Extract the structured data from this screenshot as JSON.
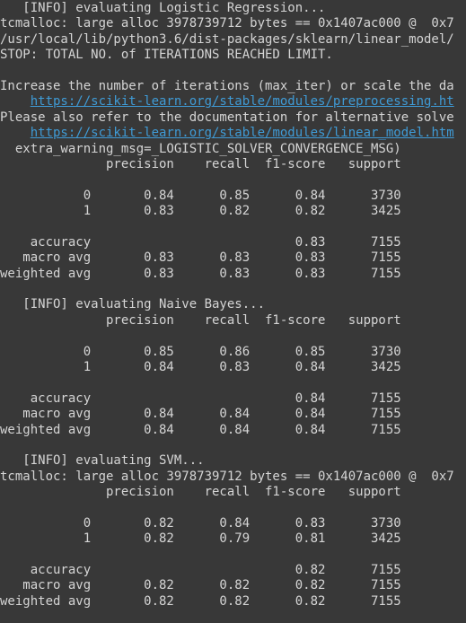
{
  "terminal": {
    "lines": [
      {
        "text": "   [INFO] evaluating Logistic Regression..."
      },
      {
        "text": "tcmalloc: large alloc 3978739712 bytes == 0x1407ac000 @  0x7"
      },
      {
        "text": "/usr/local/lib/python3.6/dist-packages/sklearn/linear_model/"
      },
      {
        "text": "STOP: TOTAL NO. of ITERATIONS REACHED LIMIT."
      },
      {
        "text": ""
      },
      {
        "text": "Increase the number of iterations (max_iter) or scale the da"
      },
      {
        "text": "    ",
        "link": "https://scikit-learn.org/stable/modules/preprocessing.ht"
      },
      {
        "text": "Please also refer to the documentation for alternative solve"
      },
      {
        "text": "    ",
        "link": "https://scikit-learn.org/stable/modules/linear_model.htm"
      },
      {
        "text": "  extra_warning_msg=_LOGISTIC_SOLVER_CONVERGENCE_MSG)"
      },
      {
        "text": "              precision    recall  f1-score   support"
      },
      {
        "text": ""
      },
      {
        "text": "           0       0.84      0.85      0.84      3730"
      },
      {
        "text": "           1       0.83      0.82      0.82      3425"
      },
      {
        "text": ""
      },
      {
        "text": "    accuracy                           0.83      7155"
      },
      {
        "text": "   macro avg       0.83      0.83      0.83      7155"
      },
      {
        "text": "weighted avg       0.83      0.83      0.83      7155"
      },
      {
        "text": ""
      },
      {
        "text": "   [INFO] evaluating Naive Bayes..."
      },
      {
        "text": "              precision    recall  f1-score   support"
      },
      {
        "text": ""
      },
      {
        "text": "           0       0.85      0.86      0.85      3730"
      },
      {
        "text": "           1       0.84      0.83      0.84      3425"
      },
      {
        "text": ""
      },
      {
        "text": "    accuracy                           0.84      7155"
      },
      {
        "text": "   macro avg       0.84      0.84      0.84      7155"
      },
      {
        "text": "weighted avg       0.84      0.84      0.84      7155"
      },
      {
        "text": ""
      },
      {
        "text": "   [INFO] evaluating SVM..."
      },
      {
        "text": "tcmalloc: large alloc 3978739712 bytes == 0x1407ac000 @  0x7"
      },
      {
        "text": "              precision    recall  f1-score   support"
      },
      {
        "text": ""
      },
      {
        "text": "           0       0.82      0.84      0.83      3730"
      },
      {
        "text": "           1       0.82      0.79      0.81      3425"
      },
      {
        "text": ""
      },
      {
        "text": "    accuracy                           0.82      7155"
      },
      {
        "text": "   macro avg       0.82      0.82      0.82      7155"
      },
      {
        "text": "weighted avg       0.82      0.82      0.82      7155"
      }
    ]
  },
  "colors": {
    "background": "#383838",
    "text": "#d5d5d5",
    "link": "#3f9bd6"
  }
}
